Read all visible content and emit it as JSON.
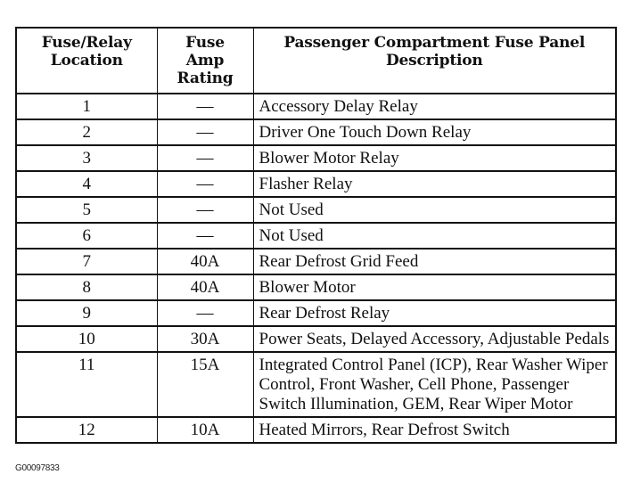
{
  "table": {
    "headers": {
      "location": "Fuse/Relay Location",
      "location_line1": "Fuse/Relay",
      "location_line2": "Location",
      "amp_line1": "Fuse",
      "amp_line2": "Amp",
      "amp_line3": "Rating",
      "desc_line1": "Passenger Compartment Fuse Panel",
      "desc_line2": "Description"
    },
    "rows": [
      {
        "location": "1",
        "amp": "—",
        "description": "Accessory Delay Relay"
      },
      {
        "location": "2",
        "amp": "—",
        "description": "Driver One Touch Down Relay"
      },
      {
        "location": "3",
        "amp": "—",
        "description": "Blower Motor Relay"
      },
      {
        "location": "4",
        "amp": "—",
        "description": "Flasher Relay"
      },
      {
        "location": "5",
        "amp": "—",
        "description": "Not Used"
      },
      {
        "location": "6",
        "amp": "—",
        "description": "Not Used"
      },
      {
        "location": "7",
        "amp": "40A",
        "description": "Rear Defrost Grid Feed"
      },
      {
        "location": "8",
        "amp": "40A",
        "description": "Blower Motor"
      },
      {
        "location": "9",
        "amp": "—",
        "description": "Rear Defrost Relay"
      },
      {
        "location": "10",
        "amp": "30A",
        "description": "Power Seats, Delayed Accessory, Adjustable Pedals"
      },
      {
        "location": "11",
        "amp": "15A",
        "description": "Integrated Control Panel (ICP), Rear Washer Wiper Control, Front Washer, Cell Phone, Passenger Switch Illumination, GEM, Rear Wiper Motor"
      },
      {
        "location": "12",
        "amp": "10A",
        "description": "Heated Mirrors, Rear Defrost Switch"
      }
    ]
  },
  "caption": "G00097833"
}
